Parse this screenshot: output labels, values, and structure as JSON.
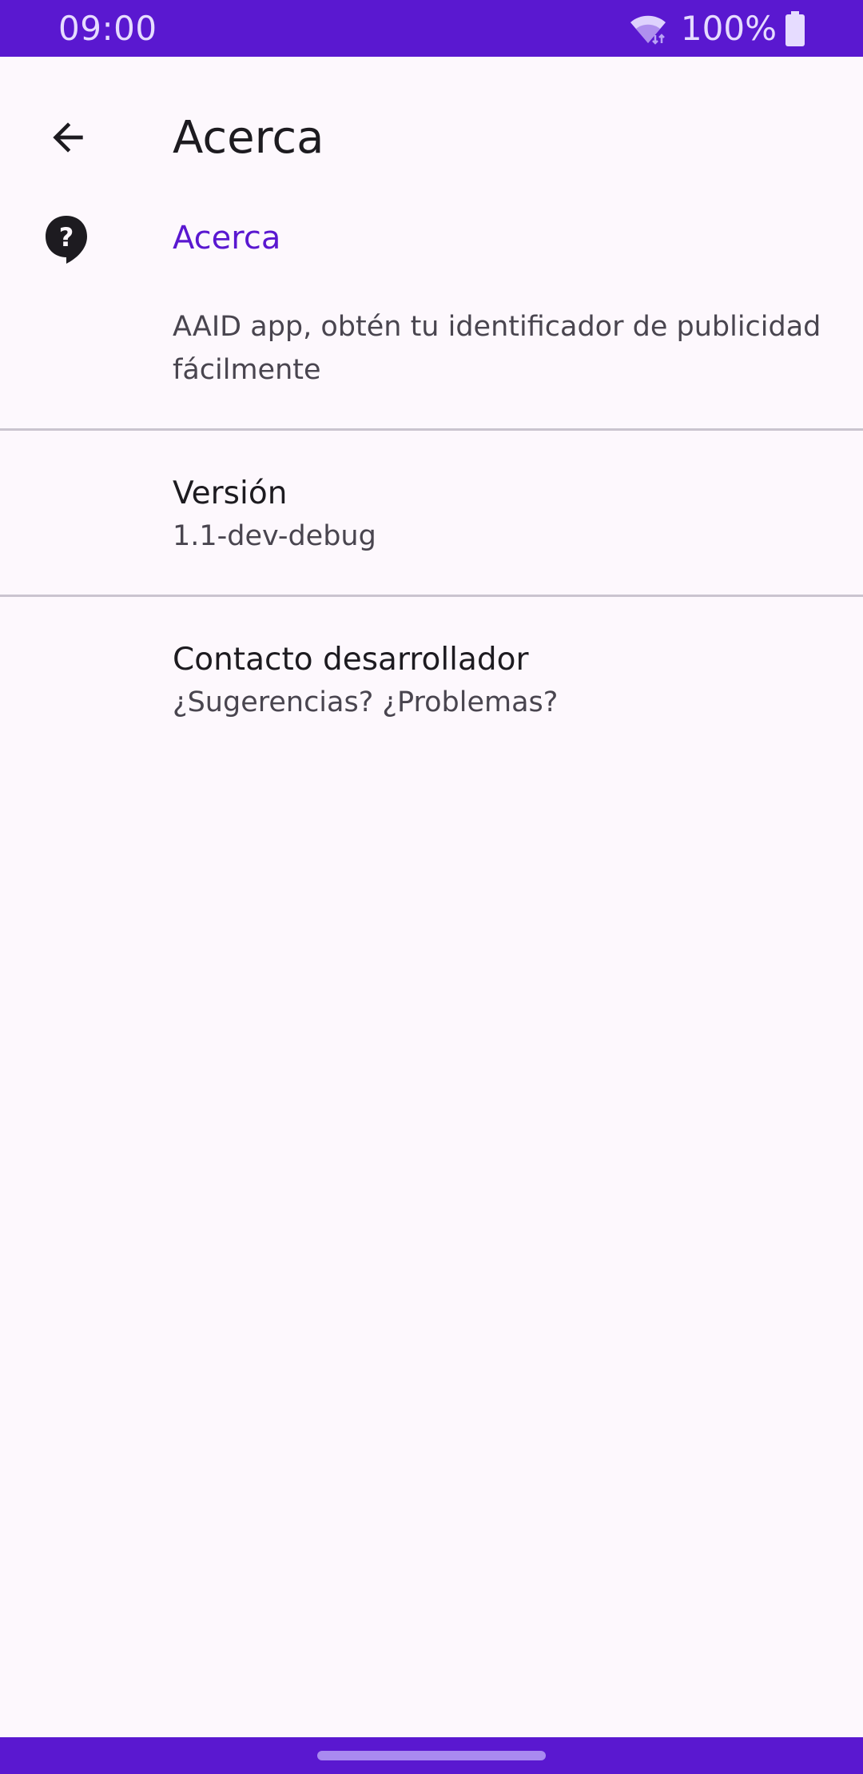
{
  "status_bar": {
    "time": "09:00",
    "battery_percent": "100%",
    "icons": [
      "wifi-icon",
      "battery-icon"
    ]
  },
  "app_bar": {
    "back_icon": "arrow-back-icon",
    "title": "Acerca"
  },
  "about": {
    "icon": "help-icon",
    "title": "Acerca",
    "summary": "AAID app, obtén tu identificador de publicidad fácilmente"
  },
  "preferences": [
    {
      "title": "Versión",
      "summary": "1.1-dev-debug"
    },
    {
      "title": "Contacto desarrollador",
      "summary": "¿Sugerencias? ¿Problemas?"
    }
  ],
  "colors": {
    "primary": "#5a18d0",
    "background": "#fdf8fd",
    "text_primary": "#1d1b20",
    "text_secondary": "#49454f",
    "divider": "#cac4cf"
  }
}
